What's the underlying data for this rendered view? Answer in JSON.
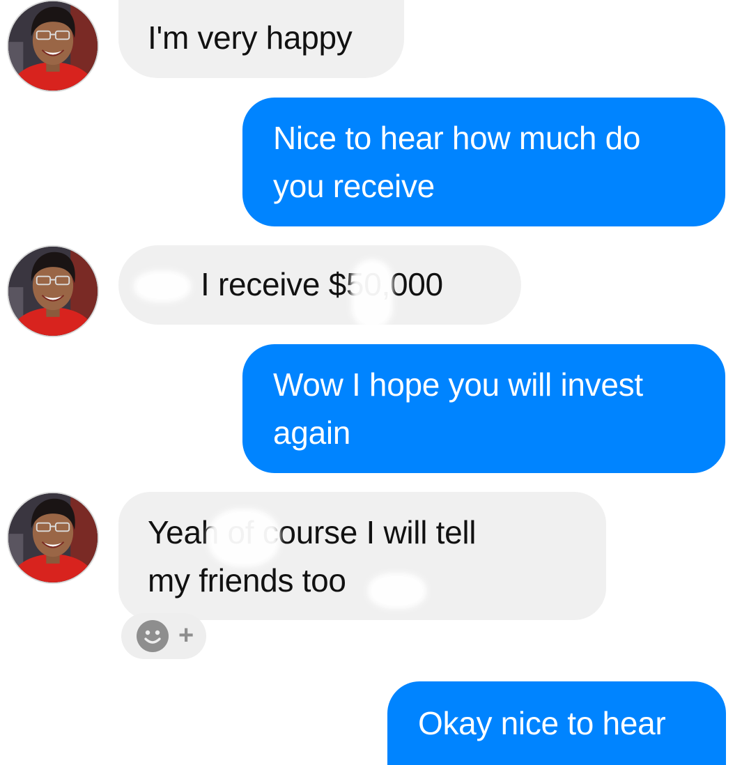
{
  "conversation": {
    "messages": [
      {
        "sender": "contact",
        "text": "I'm very happy"
      },
      {
        "sender": "me",
        "line1": "Nice to hear how much do",
        "line2": "you receive"
      },
      {
        "sender": "contact",
        "text": "I receive $50,000"
      },
      {
        "sender": "me",
        "line1": "Wow I hope you will invest",
        "line2": "again"
      },
      {
        "sender": "contact",
        "line1": "Yeah of course I will tell",
        "line2": "my friends too"
      },
      {
        "sender": "me",
        "text": "Okay nice to hear"
      }
    ]
  },
  "reaction_bar": {
    "icon": "smiley-icon",
    "add_symbol": "+"
  },
  "colors": {
    "outgoing_bubble": "#0084ff",
    "incoming_bubble": "#f0f0f0",
    "background": "#ffffff"
  }
}
